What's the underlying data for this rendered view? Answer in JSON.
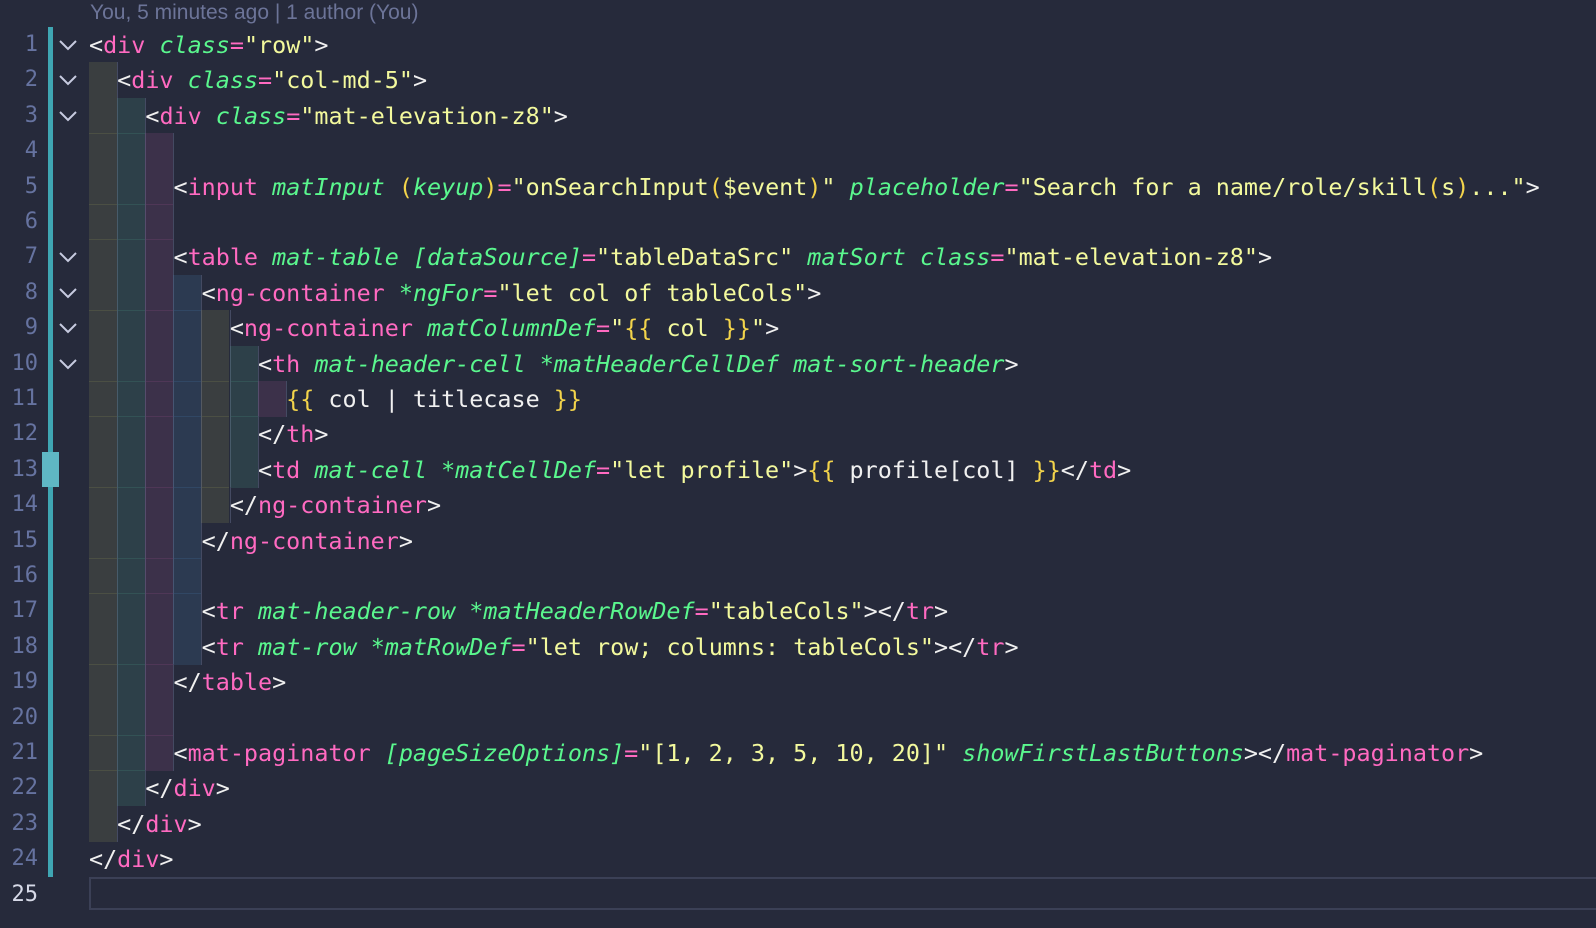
{
  "codelens": "You, 5 minutes ago | 1 author (You)",
  "active_line": 25,
  "colors": {
    "background": "#262a3b",
    "tag": "#ff6ac1",
    "attribute": "#5af78e",
    "string": "#f3f99d",
    "interpolation_brace": "#f3d44b",
    "git_added": "#3fa6b3"
  },
  "lines": [
    {
      "n": "1",
      "fold": true,
      "tokens": [
        [
          "p",
          "<"
        ],
        [
          "t",
          "div"
        ],
        [
          "w",
          " "
        ],
        [
          "a",
          "class"
        ],
        [
          "t",
          "="
        ],
        [
          "s",
          "\"row\""
        ],
        [
          "p",
          ">"
        ]
      ]
    },
    {
      "n": "2",
      "fold": true,
      "tokens": [
        [
          "w",
          "  "
        ],
        [
          "p",
          "<"
        ],
        [
          "t",
          "div"
        ],
        [
          "w",
          " "
        ],
        [
          "a",
          "class"
        ],
        [
          "t",
          "="
        ],
        [
          "s",
          "\"col-md-5\""
        ],
        [
          "p",
          ">"
        ]
      ]
    },
    {
      "n": "3",
      "fold": true,
      "tokens": [
        [
          "w",
          "    "
        ],
        [
          "p",
          "<"
        ],
        [
          "t",
          "div"
        ],
        [
          "w",
          " "
        ],
        [
          "a",
          "class"
        ],
        [
          "t",
          "="
        ],
        [
          "s",
          "\"mat-elevation-z8\""
        ],
        [
          "p",
          ">"
        ]
      ]
    },
    {
      "n": "4",
      "fold": false,
      "tokens": []
    },
    {
      "n": "5",
      "fold": false,
      "tokens": [
        [
          "w",
          "      "
        ],
        [
          "p",
          "<"
        ],
        [
          "t",
          "input"
        ],
        [
          "w",
          " "
        ],
        [
          "a",
          "matInput"
        ],
        [
          "w",
          " "
        ],
        [
          "b",
          "("
        ],
        [
          "a",
          "keyup"
        ],
        [
          "b",
          ")"
        ],
        [
          "t",
          "="
        ],
        [
          "s",
          "\"onSearchInput"
        ],
        [
          "b",
          "("
        ],
        [
          "s",
          "$event"
        ],
        [
          "b",
          ")"
        ],
        [
          "s",
          "\""
        ],
        [
          "w",
          " "
        ],
        [
          "a",
          "placeholder"
        ],
        [
          "t",
          "="
        ],
        [
          "s",
          "\"Search for a name/role/skill"
        ],
        [
          "b",
          "("
        ],
        [
          "s",
          "s"
        ],
        [
          "b",
          ")"
        ],
        [
          "s",
          "...\""
        ],
        [
          "p",
          ">"
        ]
      ]
    },
    {
      "n": "6",
      "fold": false,
      "tokens": []
    },
    {
      "n": "7",
      "fold": true,
      "tokens": [
        [
          "w",
          "      "
        ],
        [
          "p",
          "<"
        ],
        [
          "t",
          "table"
        ],
        [
          "w",
          " "
        ],
        [
          "a",
          "mat-table"
        ],
        [
          "w",
          " "
        ],
        [
          "a",
          "[dataSource]"
        ],
        [
          "t",
          "="
        ],
        [
          "s",
          "\"tableDataSrc\""
        ],
        [
          "w",
          " "
        ],
        [
          "a",
          "matSort"
        ],
        [
          "w",
          " "
        ],
        [
          "a",
          "class"
        ],
        [
          "t",
          "="
        ],
        [
          "s",
          "\"mat-elevation-z8\""
        ],
        [
          "p",
          ">"
        ]
      ]
    },
    {
      "n": "8",
      "fold": true,
      "tokens": [
        [
          "w",
          "        "
        ],
        [
          "p",
          "<"
        ],
        [
          "t",
          "ng-container"
        ],
        [
          "w",
          " "
        ],
        [
          "a",
          "*ngFor"
        ],
        [
          "t",
          "="
        ],
        [
          "s",
          "\"let col of tableCols\""
        ],
        [
          "p",
          ">"
        ]
      ]
    },
    {
      "n": "9",
      "fold": true,
      "tokens": [
        [
          "w",
          "          "
        ],
        [
          "p",
          "<"
        ],
        [
          "t",
          "ng-container"
        ],
        [
          "w",
          " "
        ],
        [
          "a",
          "matColumnDef"
        ],
        [
          "t",
          "="
        ],
        [
          "s",
          "\""
        ],
        [
          "b",
          "{{"
        ],
        [
          "s",
          " col "
        ],
        [
          "b",
          "}}"
        ],
        [
          "s",
          "\""
        ],
        [
          "p",
          ">"
        ]
      ]
    },
    {
      "n": "10",
      "fold": true,
      "tokens": [
        [
          "w",
          "            "
        ],
        [
          "p",
          "<"
        ],
        [
          "t",
          "th"
        ],
        [
          "w",
          " "
        ],
        [
          "a",
          "mat-header-cell"
        ],
        [
          "w",
          " "
        ],
        [
          "a",
          "*matHeaderCellDef"
        ],
        [
          "w",
          " "
        ],
        [
          "a",
          "mat-sort-header"
        ],
        [
          "p",
          ">"
        ]
      ]
    },
    {
      "n": "11",
      "fold": false,
      "tokens": [
        [
          "w",
          "              "
        ],
        [
          "b",
          "{{"
        ],
        [
          "w",
          " col | titlecase "
        ],
        [
          "b",
          "}}"
        ]
      ]
    },
    {
      "n": "12",
      "fold": false,
      "tokens": [
        [
          "w",
          "            "
        ],
        [
          "p",
          "</"
        ],
        [
          "t",
          "th"
        ],
        [
          "p",
          ">"
        ]
      ]
    },
    {
      "n": "13",
      "fold": false,
      "tokens": [
        [
          "w",
          "            "
        ],
        [
          "p",
          "<"
        ],
        [
          "t",
          "td"
        ],
        [
          "w",
          " "
        ],
        [
          "a",
          "mat-cell"
        ],
        [
          "w",
          " "
        ],
        [
          "a",
          "*matCellDef"
        ],
        [
          "t",
          "="
        ],
        [
          "s",
          "\"let profile\""
        ],
        [
          "p",
          ">"
        ],
        [
          "b",
          "{{"
        ],
        [
          "w",
          " profile[col] "
        ],
        [
          "b",
          "}}"
        ],
        [
          "p",
          "</"
        ],
        [
          "t",
          "td"
        ],
        [
          "p",
          ">"
        ]
      ]
    },
    {
      "n": "14",
      "fold": false,
      "tokens": [
        [
          "w",
          "          "
        ],
        [
          "p",
          "</"
        ],
        [
          "t",
          "ng-container"
        ],
        [
          "p",
          ">"
        ]
      ]
    },
    {
      "n": "15",
      "fold": false,
      "tokens": [
        [
          "w",
          "        "
        ],
        [
          "p",
          "</"
        ],
        [
          "t",
          "ng-container"
        ],
        [
          "p",
          ">"
        ]
      ]
    },
    {
      "n": "16",
      "fold": false,
      "tokens": []
    },
    {
      "n": "17",
      "fold": false,
      "tokens": [
        [
          "w",
          "        "
        ],
        [
          "p",
          "<"
        ],
        [
          "t",
          "tr"
        ],
        [
          "w",
          " "
        ],
        [
          "a",
          "mat-header-row"
        ],
        [
          "w",
          " "
        ],
        [
          "a",
          "*matHeaderRowDef"
        ],
        [
          "t",
          "="
        ],
        [
          "s",
          "\"tableCols\""
        ],
        [
          "p",
          "></"
        ],
        [
          "t",
          "tr"
        ],
        [
          "p",
          ">"
        ]
      ]
    },
    {
      "n": "18",
      "fold": false,
      "tokens": [
        [
          "w",
          "        "
        ],
        [
          "p",
          "<"
        ],
        [
          "t",
          "tr"
        ],
        [
          "w",
          " "
        ],
        [
          "a",
          "mat-row"
        ],
        [
          "w",
          " "
        ],
        [
          "a",
          "*matRowDef"
        ],
        [
          "t",
          "="
        ],
        [
          "s",
          "\"let row; columns: tableCols\""
        ],
        [
          "p",
          "></"
        ],
        [
          "t",
          "tr"
        ],
        [
          "p",
          ">"
        ]
      ]
    },
    {
      "n": "19",
      "fold": false,
      "tokens": [
        [
          "w",
          "      "
        ],
        [
          "p",
          "</"
        ],
        [
          "t",
          "table"
        ],
        [
          "p",
          ">"
        ]
      ]
    },
    {
      "n": "20",
      "fold": false,
      "tokens": []
    },
    {
      "n": "21",
      "fold": false,
      "tokens": [
        [
          "w",
          "      "
        ],
        [
          "p",
          "<"
        ],
        [
          "t",
          "mat-paginator"
        ],
        [
          "w",
          " "
        ],
        [
          "a",
          "[pageSizeOptions]"
        ],
        [
          "t",
          "="
        ],
        [
          "s",
          "\"[1, 2, 3, 5, 10, 20]\""
        ],
        [
          "w",
          " "
        ],
        [
          "a",
          "showFirstLastButtons"
        ],
        [
          "p",
          "></"
        ],
        [
          "t",
          "mat-paginator"
        ],
        [
          "p",
          ">"
        ]
      ]
    },
    {
      "n": "22",
      "fold": false,
      "tokens": [
        [
          "w",
          "    "
        ],
        [
          "p",
          "</"
        ],
        [
          "t",
          "div"
        ],
        [
          "p",
          ">"
        ]
      ]
    },
    {
      "n": "23",
      "fold": false,
      "tokens": [
        [
          "w",
          "  "
        ],
        [
          "p",
          "</"
        ],
        [
          "t",
          "div"
        ],
        [
          "p",
          ">"
        ]
      ]
    },
    {
      "n": "24",
      "fold": false,
      "tokens": [
        [
          "p",
          "</"
        ],
        [
          "t",
          "div"
        ],
        [
          "p",
          ">"
        ]
      ]
    },
    {
      "n": "25",
      "fold": false,
      "tokens": []
    }
  ]
}
